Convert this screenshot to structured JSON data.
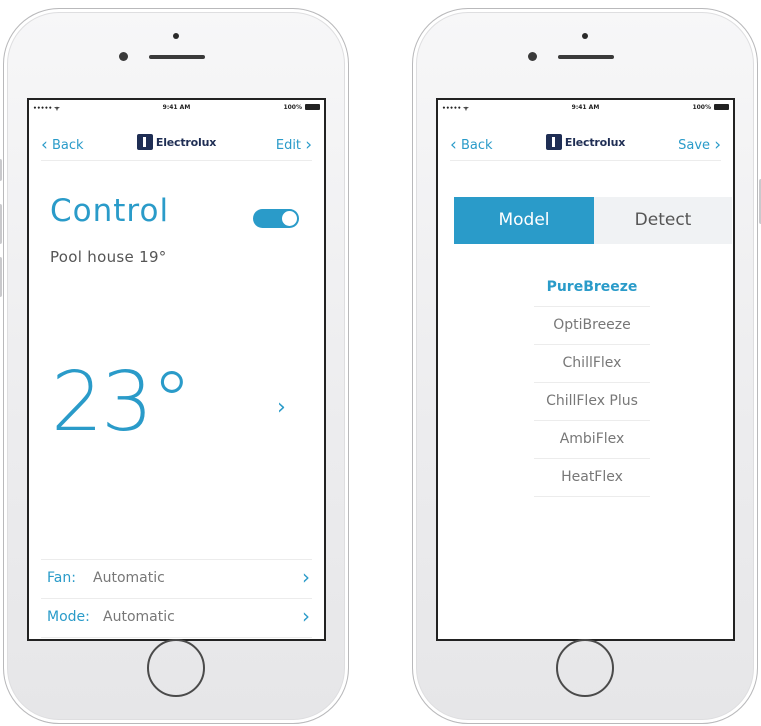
{
  "colors": {
    "accent": "#2a9bc9",
    "brand": "#1f2e54"
  },
  "status_bar": {
    "carrier": "••••• ᯤ",
    "time": "9:41 AM",
    "battery": "100%"
  },
  "left_screen": {
    "nav": {
      "back_label": "Back",
      "brand": "Electrolux",
      "right_label": "Edit"
    },
    "title": "Control",
    "toggle_on": true,
    "subtitle": "Pool house 19°",
    "temperature": "23°",
    "settings": [
      {
        "key": "Fan:",
        "value": "Automatic"
      },
      {
        "key": "Mode:",
        "value": "Automatic"
      }
    ]
  },
  "right_screen": {
    "nav": {
      "back_label": "Back",
      "brand": "Electrolux",
      "right_label": "Save"
    },
    "segments": [
      "Model",
      "Detect"
    ],
    "selected_segment": "Model",
    "models": [
      "PureBreeze",
      "OptiBreeze",
      "ChillFlex",
      "ChillFlex Plus",
      "AmbiFlex",
      "HeatFlex"
    ],
    "selected_model": "PureBreeze"
  }
}
